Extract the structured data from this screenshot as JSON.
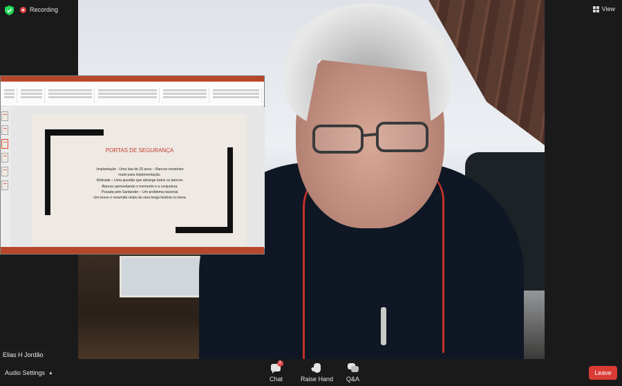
{
  "top_bar": {
    "recording_label": "Recording",
    "view_label": "View",
    "icons": [
      "shield-check-icon",
      "recording-icon",
      "view-grid-icon"
    ]
  },
  "participant": {
    "name": "Elias H Jordão"
  },
  "shared_screen": {
    "slide": {
      "title": "PORTAS DE SEGURANÇA",
      "lines": [
        "-Implantação - Uma luta de 20 anos – Bancos resistiram",
        "muito para implementação.",
        "-Retirada – Uma questão que abrange todos os bancos:",
        "-Bancos aproveitando o momento e a conjuntura.",
        "-Puxada pelo Santander – Um problema nacional.",
        "-Um breve e resumido relato de uma longa história no tema."
      ]
    }
  },
  "toolbar": {
    "audio_label": "Audio Settings",
    "chat_label": "Chat",
    "chat_badge": "3",
    "raise_hand_label": "Raise Hand",
    "qa_label": "Q&A",
    "leave_label": "Leave"
  },
  "colors": {
    "leave": "#d93c35",
    "badge": "#e34646",
    "powerpoint": "#b7472a",
    "slide_title": "#c0392b"
  }
}
